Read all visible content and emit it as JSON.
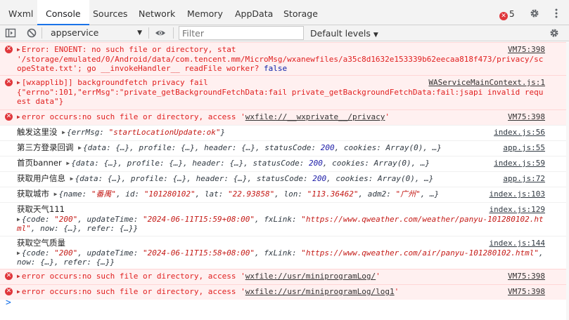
{
  "tabs": [
    {
      "label": "Wxml"
    },
    {
      "label": "Console"
    },
    {
      "label": "Sources"
    },
    {
      "label": "Network"
    },
    {
      "label": "Memory"
    },
    {
      "label": "AppData"
    },
    {
      "label": "Storage"
    }
  ],
  "header": {
    "error_count": "5"
  },
  "toolbar": {
    "context": "appservice",
    "filter_placeholder": "Filter",
    "levels": "Default levels"
  },
  "rows": {
    "r1": {
      "line1": "Error: ENOENT: no such file or directory, stat",
      "line2": "'/storage/emulated/0/Android/data/com.tencent.mm/MicroMsg/wxanewfiles/a35c8d1632e153339b62eecaa818f473/privacy/scopeState.txt'; go __invokeHandler__ readFile worker?",
      "kw": "false",
      "src": "VM75:398"
    },
    "r2": {
      "text": "[wxapplib]] backgroundfetch privacy fail\n{\"errno\":101,\"errMsg\":\"private_getBackgroundFetchData:fail private_getBackgroundFetchData:fail:jsapi invalid request data\"}",
      "src": "WAServiceMainContext.js:1"
    },
    "r3": {
      "pre": "error occurs:no such file or directory, access '",
      "path": "wxfile://__wxprivate__/privacy",
      "post": "'",
      "src": "VM75:398"
    },
    "r4": {
      "label": "触发这里没",
      "k1": "{errMsg: ",
      "v1": "\"startLocationUpdate:ok\"",
      "end": "}",
      "src": "index.js:56"
    },
    "r5": {
      "label": "第三方登录回调",
      "body": "{data: {…}, profile: {…}, header: {…}, statusCode: ",
      "num": "200",
      "tail": ", cookies: Array(0), …}",
      "src": "app.js:55"
    },
    "r6": {
      "label": "首页banner",
      "body": "{data: {…}, profile: {…}, header: {…}, statusCode: ",
      "num": "200",
      "tail": ", cookies: Array(0), …}",
      "src": "index.js:59"
    },
    "r7": {
      "label": "获取用户信息",
      "body": "{data: {…}, profile: {…}, header: {…}, statusCode: ",
      "num": "200",
      "tail": ", cookies: Array(0), …}",
      "src": "app.js:72"
    },
    "r8": {
      "label": "获取城市",
      "a": "{name: ",
      "name": "\"番禺\"",
      "b": ", id: ",
      "id": "\"101280102\"",
      "c": ", lat: ",
      "lat": "\"22.93858\"",
      "d": ", lon: ",
      "lon": "\"113.36462\"",
      "e": ", adm2: ",
      "adm2": "\"广州\"",
      "f": ", …}",
      "src": "index.js:103"
    },
    "r9": {
      "label": "获取天气111",
      "a": "{code: ",
      "code": "\"200\"",
      "b": ", updateTime: ",
      "time": "\"2024-06-11T15:59+08:00\"",
      "c": ", fxLink: ",
      "link": "\"https://www.qweather.com/weather/panyu-101280102.html\"",
      "d": ", now: {…}, refer: {…}}",
      "src": "index.js:129"
    },
    "r10": {
      "label": "获取空气质量",
      "a": "{code: ",
      "code": "\"200\"",
      "b": ", updateTime: ",
      "time": "\"2024-06-11T15:58+08:00\"",
      "c": ", fxLink: ",
      "link": "\"https://www.qweather.com/air/panyu-101280102.html\"",
      "d": ",\nnow: {…}, refer: {…}}",
      "src": "index.js:144"
    },
    "r11": {
      "pre": "error occurs:no such file or directory, access '",
      "path": "wxfile://usr/miniprogramLog/",
      "post": "'",
      "src": "VM75:398"
    },
    "r12": {
      "pre": "error occurs:no such file or directory, access '",
      "path": "wxfile://usr/miniprogramLog/log1",
      "post": "'",
      "src": "VM75:398"
    }
  },
  "prompt": ">"
}
